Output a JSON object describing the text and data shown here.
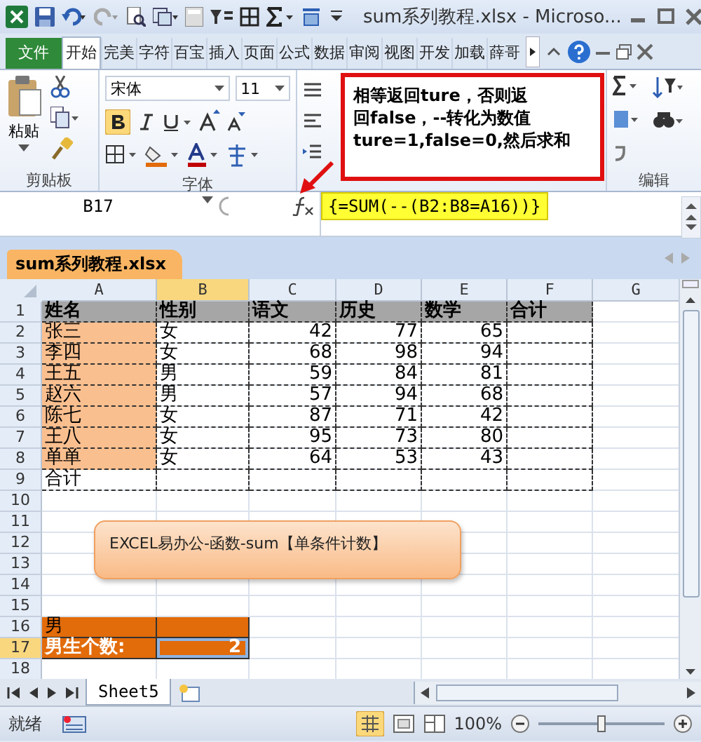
{
  "window": {
    "title": "sum系列教程.xlsx  -  Microso..."
  },
  "ribbon_tabs": [
    {
      "label": "文件",
      "kind": "file",
      "selected": false
    },
    {
      "label": "开始",
      "kind": "tab",
      "selected": true
    },
    {
      "label": "完美",
      "kind": "tab",
      "selected": false
    },
    {
      "label": "字符",
      "kind": "tab",
      "selected": false
    },
    {
      "label": "百宝",
      "kind": "tab",
      "selected": false
    },
    {
      "label": "插入",
      "kind": "tab",
      "selected": false
    },
    {
      "label": "页面",
      "kind": "tab",
      "selected": false
    },
    {
      "label": "公式",
      "kind": "tab",
      "selected": false
    },
    {
      "label": "数据",
      "kind": "tab",
      "selected": false
    },
    {
      "label": "审阅",
      "kind": "tab",
      "selected": false
    },
    {
      "label": "视图",
      "kind": "tab",
      "selected": false
    },
    {
      "label": "开发",
      "kind": "tab",
      "selected": false
    },
    {
      "label": "加载",
      "kind": "tab",
      "selected": false
    },
    {
      "label": "薛哥",
      "kind": "tab",
      "selected": false
    }
  ],
  "ribbon": {
    "paste_label": "粘贴",
    "font_name": "宋体",
    "font_size": "11",
    "groups": [
      "剪贴板",
      "字体",
      "编辑"
    ]
  },
  "callout": {
    "lines": [
      "相等返回ture，否则返",
      "回false，--转化为数值",
      "ture=1,false=0,然后求和"
    ]
  },
  "formula_bar": {
    "name_box": "B17",
    "formula": "{=SUM(--(B2:B8=A16))}"
  },
  "workbook_tab": "sum系列教程.xlsx",
  "columns": [
    {
      "label": "A",
      "selected": false
    },
    {
      "label": "B",
      "selected": true
    },
    {
      "label": "C",
      "selected": false
    },
    {
      "label": "D",
      "selected": false
    },
    {
      "label": "E",
      "selected": false
    },
    {
      "label": "F",
      "selected": false
    },
    {
      "label": "G",
      "selected": false
    }
  ],
  "rows": [
    {
      "number": "1",
      "kind": "header",
      "selected": false,
      "cells": [
        "姓名",
        "性别",
        "语文",
        "历史",
        "数学",
        "合计"
      ]
    },
    {
      "number": "2",
      "kind": "data",
      "selected": false,
      "cells": [
        "张三",
        "女",
        "42",
        "77",
        "65"
      ]
    },
    {
      "number": "3",
      "kind": "data",
      "selected": false,
      "cells": [
        "李四",
        "女",
        "68",
        "98",
        "94"
      ]
    },
    {
      "number": "4",
      "kind": "data",
      "selected": false,
      "cells": [
        "王五",
        "男",
        "59",
        "84",
        "81"
      ]
    },
    {
      "number": "5",
      "kind": "data",
      "selected": false,
      "cells": [
        "赵六",
        "男",
        "57",
        "94",
        "68"
      ]
    },
    {
      "number": "6",
      "kind": "data",
      "selected": false,
      "cells": [
        "陈七",
        "女",
        "87",
        "71",
        "42"
      ]
    },
    {
      "number": "7",
      "kind": "data",
      "selected": false,
      "cells": [
        "王八",
        "女",
        "95",
        "73",
        "80"
      ]
    },
    {
      "number": "8",
      "kind": "data",
      "selected": false,
      "cells": [
        "单单",
        "女",
        "64",
        "53",
        "43"
      ]
    },
    {
      "number": "9",
      "kind": "total",
      "selected": false,
      "cells": [
        "合计"
      ]
    },
    {
      "number": "10",
      "kind": "blank",
      "selected": false
    },
    {
      "number": "11",
      "kind": "blank",
      "selected": false
    },
    {
      "number": "12",
      "kind": "blank",
      "selected": false
    },
    {
      "number": "13",
      "kind": "blank",
      "selected": false
    },
    {
      "number": "14",
      "kind": "blank",
      "selected": false
    },
    {
      "number": "15",
      "kind": "blank",
      "selected": false
    },
    {
      "number": "16",
      "kind": "criteria",
      "selected": false,
      "cells": [
        "男"
      ]
    },
    {
      "number": "17",
      "kind": "result",
      "selected": true,
      "cells": [
        "男生个数:",
        "2"
      ]
    },
    {
      "number": "18",
      "kind": "blank",
      "selected": false
    }
  ],
  "shape": {
    "text": "EXCEL易办公-函数-sum【单条件计数】"
  },
  "sheet_tabs": [
    {
      "label": "Sheet5",
      "selected": true
    }
  ],
  "status_bar": {
    "status": "就绪",
    "zoom": {
      "reading": "100%",
      "level": 0.5
    }
  }
}
